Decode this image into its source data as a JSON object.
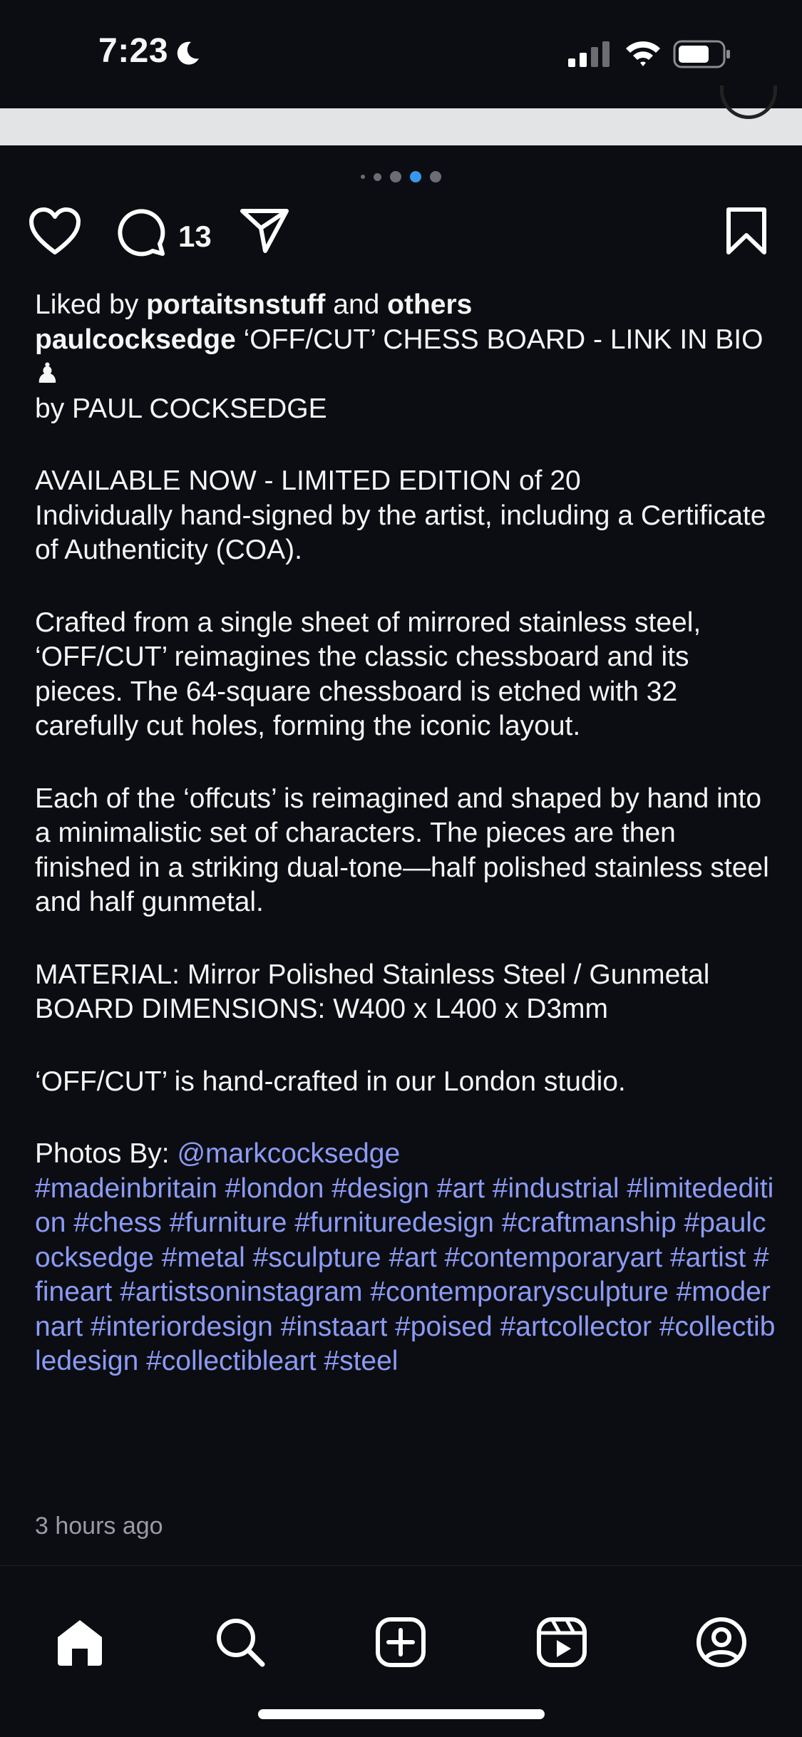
{
  "status_bar": {
    "time": "7:23"
  },
  "carousel": {
    "dot_count": 5,
    "active_index": 3
  },
  "actions": {
    "comment_count": "13"
  },
  "caption": {
    "liked_prefix": "Liked by ",
    "liked_user": "portaitsnstuff",
    "liked_mid": " and ",
    "liked_others": "others",
    "author": "paulcocksedge",
    "title_text": " ‘OFF/CUT’ CHESS BOARD - LINK IN BIO ♟",
    "by_line": "by PAUL COCKSEDGE",
    "available": "AVAILABLE NOW - LIMITED EDITION of 20",
    "signed": "Individually hand-signed by the artist, including a Certificate of Authenticity (COA).",
    "crafted": "Crafted from a single sheet of mirrored stainless steel, ‘OFF/CUT’ reimagines the classic chessboard and its pieces. The 64-square chessboard is etched with 32 carefully cut holes, forming the iconic layout.",
    "offcuts": "Each of the ‘offcuts’ is reimagined and shaped by hand into a minimalistic set of characters. The pieces are then finished in a striking dual-tone—half polished stainless steel and half gunmetal.",
    "material": "MATERIAL: Mirror Polished Stainless Steel / Gunmetal",
    "dimensions": "BOARD DIMENSIONS: W400 x L400 x D3mm",
    "studio": "‘OFF/CUT’ is hand-crafted in our London studio.",
    "photos_by_label": "Photos By: ",
    "photos_by_handle": "@markcocksedge",
    "hashtags": "#madeinbritain #london #design #art #industrial #limitededition #chess #furniture #furnituredesign #craftmanship #paulcocksedge #metal #sculpture #art #contemporaryart #artist #fineart #artistsoninstagram #contemporarysculpture #modernart #interiordesign #instaart #poised #artcollector #collectibledesign #collectibleart #steel"
  },
  "timestamp": "3 hours ago",
  "colors": {
    "background": "#0b0d12",
    "link": "#8c9bf5",
    "accent": "#3897f0"
  },
  "bottom_nav": [
    {
      "icon": "home-icon"
    },
    {
      "icon": "search-icon"
    },
    {
      "icon": "create-icon"
    },
    {
      "icon": "reels-icon"
    },
    {
      "icon": "profile-icon"
    }
  ]
}
